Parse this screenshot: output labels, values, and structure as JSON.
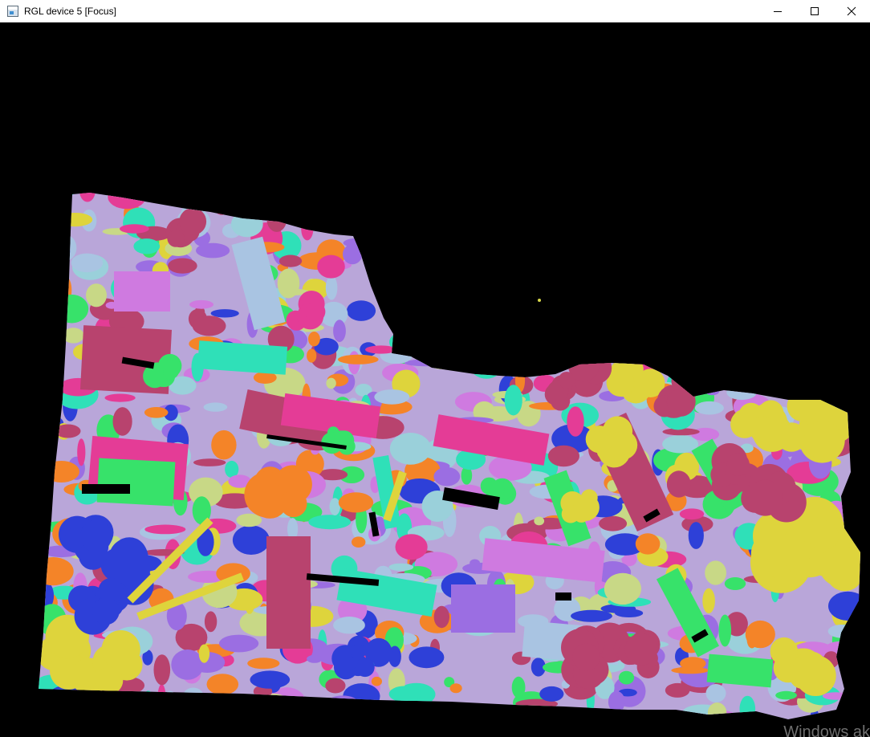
{
  "window": {
    "title": "RGL device 5 [Focus]",
    "icons": {
      "app": "rgl-app-icon",
      "minimize": "minimize-icon",
      "maximize": "maximize-icon",
      "close": "close-icon"
    }
  },
  "viewport": {
    "background": "#000000",
    "palette": [
      "#e43c96",
      "#b8436e",
      "#2fe0b8",
      "#ded43c",
      "#9ad0da",
      "#cf7ae0",
      "#a9c4e2",
      "#37e26a",
      "#2e40d8",
      "#f48428",
      "#9b6ee2",
      "#c8d886"
    ]
  },
  "watermark": "Windows ak"
}
